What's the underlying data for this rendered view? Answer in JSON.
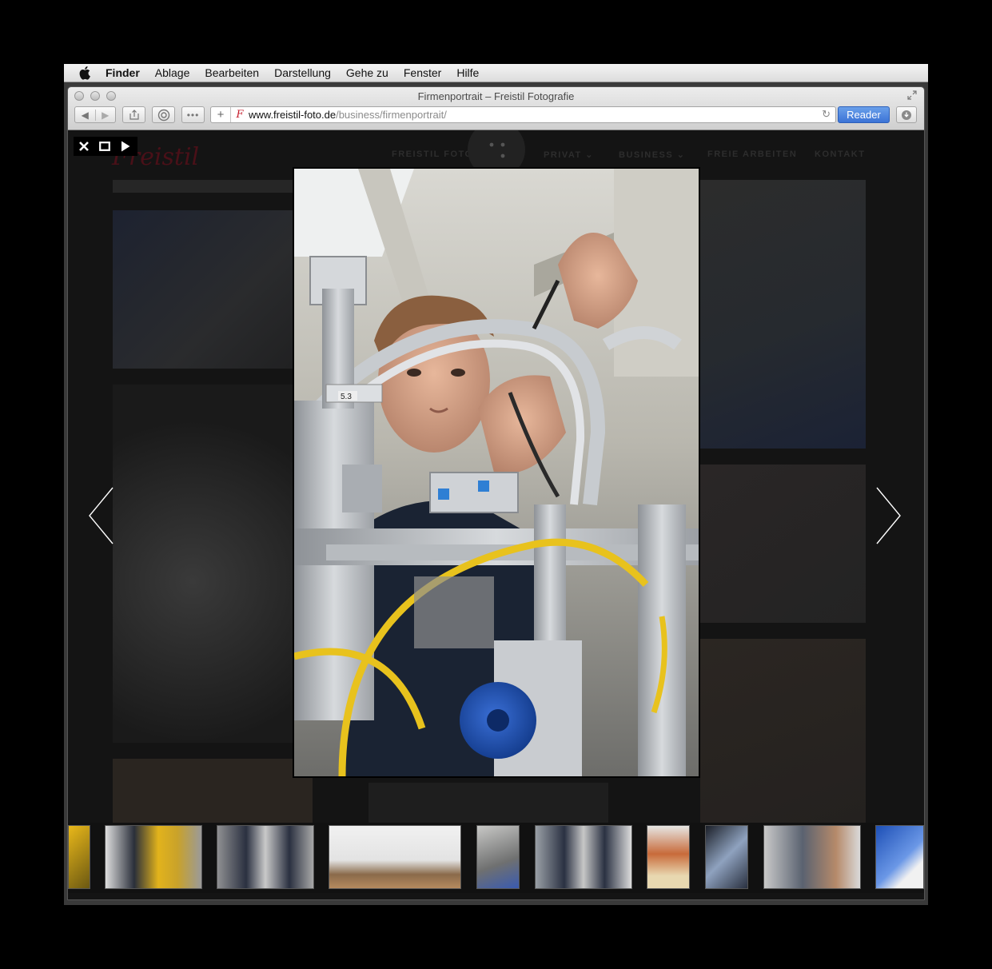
{
  "menubar": {
    "app_name": "Finder",
    "items": [
      "Ablage",
      "Bearbeiten",
      "Darstellung",
      "Gehe zu",
      "Fenster",
      "Hilfe"
    ]
  },
  "browser": {
    "window_title": "Firmenportrait – Freistil Fotografie",
    "url_host": "www.freistil-foto.de",
    "url_path": "/business/firmenportrait/",
    "reader_label": "Reader",
    "favicon_glyph": "F"
  },
  "site": {
    "logo_text": "Freistil",
    "nav": [
      "FREISTIL FOTOGRAFIE",
      "PRIVAT ⌄",
      "BUSINESS ⌄",
      "FREIE ARBEITEN",
      "KONTAKT"
    ]
  },
  "lightbox": {
    "controls": [
      "close-icon",
      "fullscreen-icon",
      "play-icon"
    ],
    "main_photo": "worker wiring a robotic assembly rig, label 5.3",
    "thumb_count": 11
  },
  "colors": {
    "reader_blue": "#3b73d6",
    "site_red": "#c41a2a"
  }
}
